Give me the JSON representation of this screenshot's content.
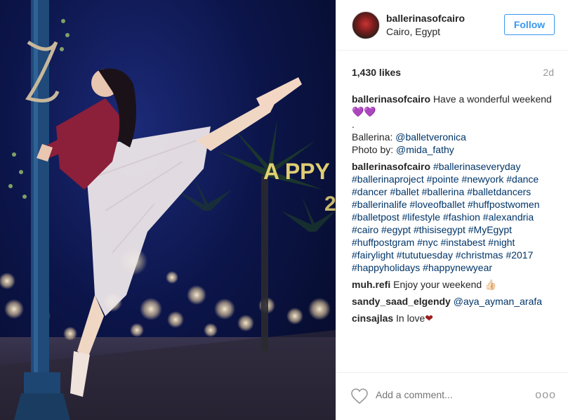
{
  "post": {
    "username": "ballerinasofcairo",
    "location": "Cairo, Egypt",
    "follow_label": "Follow",
    "likes": "1,430 likes",
    "age": "2d"
  },
  "caption": {
    "user": "ballerinasofcairo",
    "text": "Have a wonderful weekend",
    "hearts": "💜💜",
    "dot": ".",
    "ballerina_label": "Ballerina: ",
    "ballerina_link": "@balletveronica",
    "photo_label": "Photo by: ",
    "photo_link": "@mida_fathy"
  },
  "hashtags": {
    "user": "ballerinasofcairo",
    "tags": "#ballerinaseveryday #ballerinaproject #pointe #newyork #dance #dancer #ballet #ballerina #balletdancers #ballerinalife #loveofballet #huffpostwomen #balletpost #lifestyle #fashion #alexandria #cairo #egypt #thisisegypt #MyEgypt #huffpostgram #nyc #instabest #night #fairylight #tututuesday #christmas #2017 #happyholidays #happynewyear"
  },
  "comments": [
    {
      "user": "muh.refi",
      "text": "Enjoy your weekend",
      "emoji": "👍🏻"
    },
    {
      "user": "sandy_saad_elgendy",
      "mention": "@aya_ayman_arafa"
    },
    {
      "user": "cinsajlas",
      "text": "In love",
      "emoji": "❤"
    }
  ],
  "footer": {
    "comment_placeholder": "Add a comment...",
    "more_label": "ooo",
    "like_icon": "heart-outline-icon",
    "more_icon": "ellipsis-icon"
  },
  "colors": {
    "link": "#003569",
    "follow": "#3897f0",
    "muted": "#999999"
  }
}
